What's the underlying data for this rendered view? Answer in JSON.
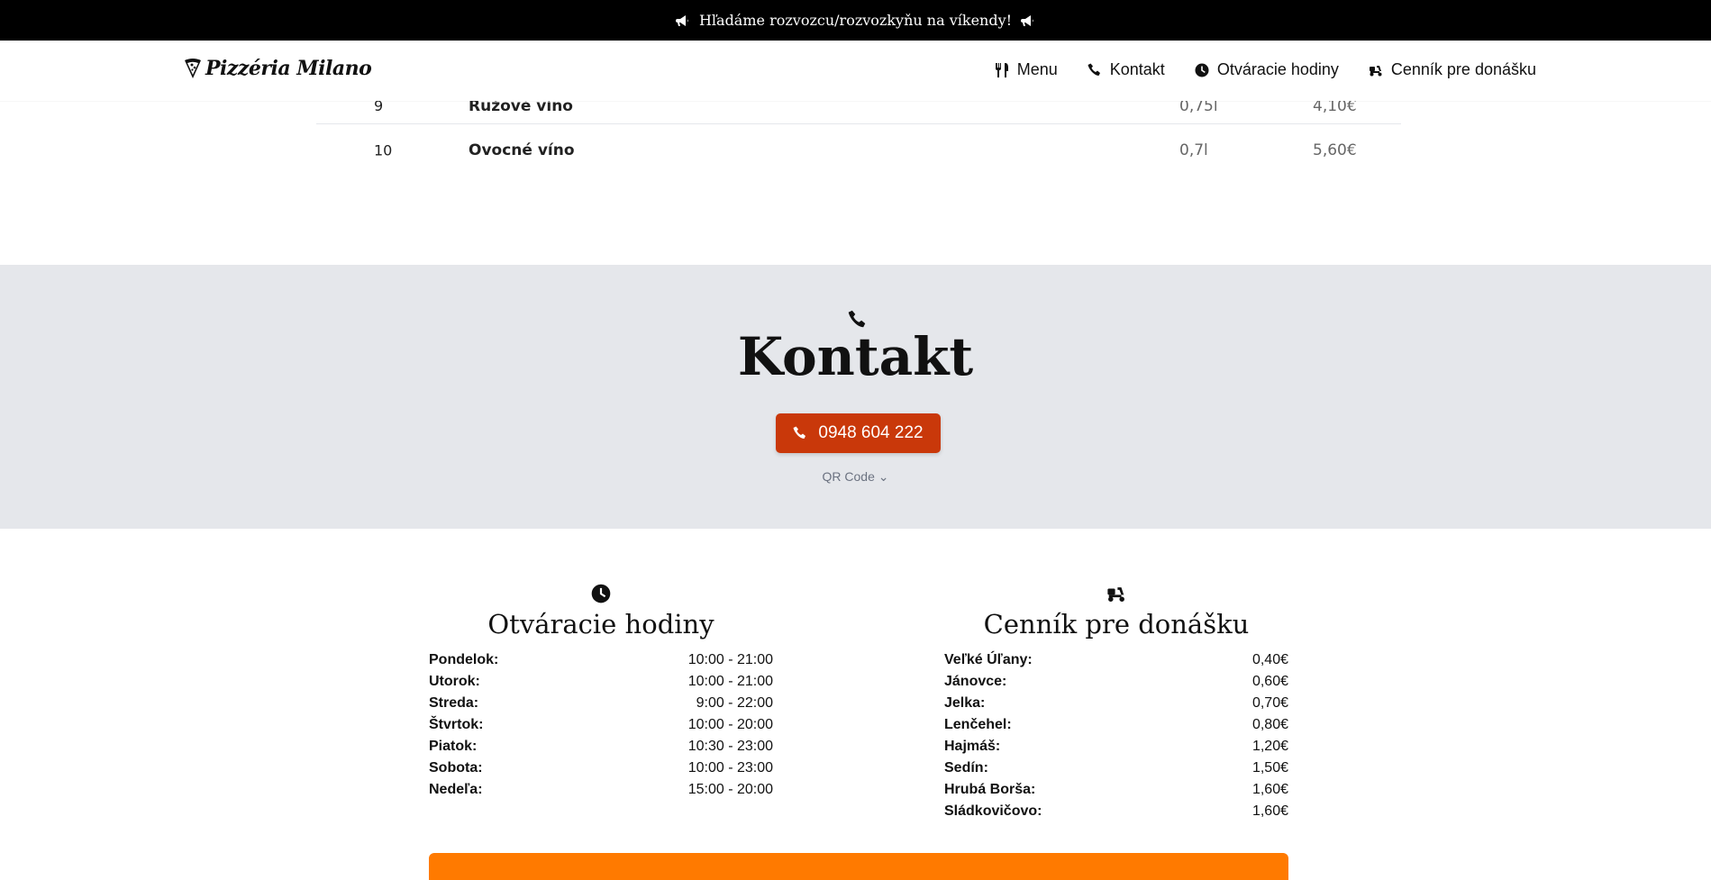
{
  "announcement": {
    "text": "Hľadáme rozvozcu/rozvozkyňu na víkendy!",
    "icon": "megaphone-icon"
  },
  "brand": {
    "name": "Pizzéria Milano",
    "icon": "pizza-slice-icon"
  },
  "nav": {
    "items": [
      {
        "label": "Menu",
        "icon": "utensils-icon"
      },
      {
        "label": "Kontakt",
        "icon": "phone-icon"
      },
      {
        "label": "Otváracie hodiny",
        "icon": "clock-icon"
      },
      {
        "label": "Cenník pre donášku",
        "icon": "scooter-icon"
      }
    ]
  },
  "menu_rows": [
    {
      "num": "9",
      "name": "Ružové víno",
      "volume": "0,75l",
      "price": "4,10€"
    },
    {
      "num": "10",
      "name": "Ovocné víno",
      "volume": "0,7l",
      "price": "5,60€"
    }
  ],
  "contact": {
    "title": "Kontakt",
    "phone": "0948 604 222",
    "qr_label": "QR Code",
    "qr_chevron": "⌄"
  },
  "hours": {
    "title": "Otváracie hodiny",
    "rows": [
      {
        "day": "Pondelok:",
        "time": "10:00 - 21:00"
      },
      {
        "day": "Utorok:",
        "time": "10:00 - 21:00"
      },
      {
        "day": "Streda:",
        "time": "9:00 - 22:00"
      },
      {
        "day": "Štvrtok:",
        "time": "10:00 - 20:00"
      },
      {
        "day": "Piatok:",
        "time": "10:30 - 23:00"
      },
      {
        "day": "Sobota:",
        "time": "10:00 - 23:00"
      },
      {
        "day": "Nedeľa:",
        "time": "15:00 - 20:00"
      }
    ]
  },
  "delivery": {
    "title": "Cenník pre donášku",
    "rows": [
      {
        "place": "Veľké Úľany:",
        "price": "0,40€"
      },
      {
        "place": "Jánovce:",
        "price": "0,60€"
      },
      {
        "place": "Jelka:",
        "price": "0,70€"
      },
      {
        "place": "Lenčehel:",
        "price": "0,80€"
      },
      {
        "place": "Hajmáš:",
        "price": "1,20€"
      },
      {
        "place": "Sedín:",
        "price": "1,50€"
      },
      {
        "place": "Hrubá Borša:",
        "price": "1,60€"
      },
      {
        "place": "Sládkovičovo:",
        "price": "1,60€"
      }
    ]
  },
  "colors": {
    "accent": "#c9380a",
    "bar": "#ff7a00",
    "band": "#e5e7eb"
  }
}
